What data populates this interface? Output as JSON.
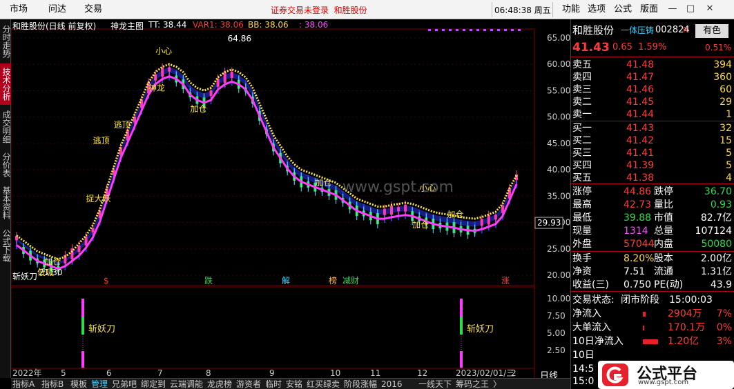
{
  "menubar": {
    "items": [
      "市场",
      "问达",
      "交易"
    ],
    "notice_left": "证券交易未登录",
    "notice_right": "和胜股份",
    "clock": "06:48:38 周五",
    "right_items": [
      "功能",
      "选项",
      "公式",
      "版面"
    ],
    "win_buttons": [
      "—",
      "□",
      "✕"
    ]
  },
  "left_tabs": [
    {
      "label": "分时走势",
      "active": false
    },
    {
      "label": "技术分析",
      "active": true
    },
    {
      "label": "成交明细",
      "active": false
    },
    {
      "label": "分价表",
      "active": false
    },
    {
      "label": "基本资料",
      "active": false
    },
    {
      "label": "公式下载",
      "active": false
    }
  ],
  "chart_header": {
    "name": "和胜股份(日线 前复权)",
    "indicator": "神龙主图",
    "tt": "TT: 38.44",
    "var1": "VAR1: 38.06",
    "bb": "BB: 38.06",
    "last": ": 38.06",
    "arrow": "↑"
  },
  "price_axis": [
    "65.00",
    "60.00",
    "55.00",
    "50.00",
    "45.00",
    "40.00",
    "35.00",
    "30.00",
    "25.00",
    "20.00"
  ],
  "current_price_tag": "29.93",
  "sub_axis": [
    "10.00",
    "7.50",
    "5.00",
    "2.50"
  ],
  "date_axis": [
    "2022年",
    "5",
    "6",
    "7",
    "8",
    "9",
    "10",
    "11",
    "12",
    "2023/02/01/三",
    "2"
  ],
  "period_label": "日线",
  "sub_indicator": "斩妖刀",
  "sub_marker_label": "斩妖刀",
  "annotations": {
    "high": "64.86",
    "low": "21.30",
    "small_heart": "小心",
    "jiacang": "加仓",
    "taoding": "逃顶",
    "tidayao": "捉大妖",
    "dixi": "低吸",
    "shenlong": "神龙"
  },
  "event_tags": [
    {
      "text": "$",
      "color": "#ff3b3b"
    },
    {
      "text": "跌",
      "color": "#2fdc4a"
    },
    {
      "text": "解",
      "color": "#3ad0ff"
    },
    {
      "text": "榜",
      "color": "#ffb347"
    },
    {
      "text": "减财",
      "color": "#2fdc4a"
    },
    {
      "text": "涨",
      "color": "#ff3b3b"
    }
  ],
  "quote": {
    "name": "和胜股份",
    "tag": "一体压铸",
    "code": "002824",
    "r_label": "R",
    "badge": "有色",
    "price": "41.43",
    "change": "0.65",
    "pct": "1.59%",
    "badge_pct": "0.51%",
    "asks": [
      {
        "label": "卖五",
        "price": "41.48",
        "vol": "394"
      },
      {
        "label": "卖四",
        "price": "41.47",
        "vol": "360"
      },
      {
        "label": "卖三",
        "price": "41.46",
        "vol": "60"
      },
      {
        "label": "卖二",
        "price": "41.45",
        "vol": "29"
      },
      {
        "label": "卖一",
        "price": "41.44",
        "vol": "1"
      }
    ],
    "bids": [
      {
        "label": "买一",
        "price": "41.43",
        "vol": "32"
      },
      {
        "label": "买二",
        "price": "41.42",
        "vol": "15"
      },
      {
        "label": "买三",
        "price": "41.41",
        "vol": "5"
      },
      {
        "label": "买四",
        "price": "41.39",
        "vol": "5"
      },
      {
        "label": "买五",
        "price": "41.38",
        "vol": "4"
      }
    ],
    "stats": [
      {
        "l1": "涨停",
        "v1": "44.86",
        "c1": "red",
        "l2": "跌停",
        "v2": "36.70",
        "c2": "green"
      },
      {
        "l1": "最高",
        "v1": "42.73",
        "c1": "red",
        "l2": "量比",
        "v2": "0.93",
        "c2": "green"
      },
      {
        "l1": "最低",
        "v1": "39.88",
        "c1": "green",
        "l2": "市值",
        "v2": "82.7亿",
        "c2": "white"
      },
      {
        "l1": "现量",
        "v1": "1314",
        "c1": "mag",
        "l2": "总量",
        "v2": "107124",
        "c2": "white"
      },
      {
        "l1": "外盘",
        "v1": "57044",
        "c1": "red",
        "l2": "内盘",
        "v2": "50080",
        "c2": "green"
      }
    ],
    "stats2": [
      {
        "l1": "换手",
        "v1": "8.20%",
        "c1": "yellow",
        "l2": "股本",
        "v2": "2.00亿",
        "c2": "white"
      },
      {
        "l1": "净资",
        "v1": "7.51",
        "c1": "white",
        "l2": "流通",
        "v2": "1.31亿",
        "c2": "white"
      },
      {
        "l1": "收益(三)",
        "v1": "0.750",
        "c1": "white",
        "l2": "PE(动)",
        "v2": "43.9",
        "c2": "white"
      }
    ],
    "status_label": "交易状态:",
    "status_value": "闭市阶段",
    "status_time": "15:00:03",
    "flows": [
      {
        "label": "净流入",
        "value": "2904万",
        "pct": "7%"
      },
      {
        "label": "大单流入",
        "value": "170.1万",
        "pct": "0%"
      },
      {
        "label": "10日净流入",
        "value": "1.20亿",
        "pct": "3%"
      },
      {
        "label": "10日",
        "value": "",
        "pct": ""
      }
    ],
    "bottom_times": [
      "14:5",
      "15:0"
    ]
  },
  "bottom_tabs": [
    "指标A",
    "指标B",
    "模板",
    "管理",
    "兄弟吧",
    "绑定到",
    "云端调能",
    "龙虎榜",
    "游资者",
    "临时",
    "安铭",
    "红买绿卖",
    "阶段涨幅",
    "2016",
    "一线天下",
    "筹码之王",
    "〉"
  ],
  "bottom_active": "管理",
  "watermark": {
    "text": "公式平台",
    "url": "www.gspt.com"
  },
  "site_watermark": "www.gspt.com",
  "chart_data": {
    "type": "line",
    "title": "",
    "xlabel": "",
    "ylabel": "",
    "ylim": [
      20,
      65
    ],
    "series": [
      {
        "name": "TT",
        "values": [
          27,
          26,
          25,
          24,
          23.5,
          23,
          22.5,
          23,
          24,
          25.5,
          27,
          29,
          32,
          36,
          40,
          44,
          47,
          50,
          53,
          56,
          58,
          59,
          59.5,
          59,
          58,
          56,
          55,
          54.5,
          55,
          57,
          58,
          58.5,
          58,
          57,
          55,
          52,
          49,
          46,
          44,
          42,
          40.5,
          39.5,
          39,
          38.5,
          38,
          37.5,
          37,
          36,
          35,
          34,
          33.5,
          33,
          32.5,
          32.5,
          32.8,
          33,
          33.2,
          33,
          32.5,
          32,
          31.5,
          31.2,
          31,
          30.8,
          30.5,
          30.3,
          30.2,
          30.5,
          31,
          31.5,
          33,
          36,
          38.4
        ]
      },
      {
        "name": "VAR1",
        "values": [
          26.5,
          25.5,
          24.5,
          23.5,
          23,
          22.5,
          22,
          22.5,
          23.5,
          24.5,
          26,
          28,
          31,
          35,
          39,
          43,
          46,
          49,
          52,
          55,
          57,
          58,
          58.5,
          58,
          57,
          55,
          54,
          53.5,
          54,
          56,
          57,
          57.5,
          57,
          56,
          54,
          51,
          48,
          45,
          43,
          41,
          39.5,
          38.5,
          38,
          37.5,
          37,
          36.5,
          36,
          35,
          34,
          33,
          32.5,
          32,
          31.5,
          31.5,
          31.8,
          32,
          32.2,
          32,
          31.5,
          31,
          30.5,
          30.2,
          30,
          29.8,
          29.5,
          29.3,
          29.2,
          29.5,
          30,
          30.5,
          32,
          35,
          38.06
        ]
      }
    ],
    "markers": [
      {
        "label": "64.86",
        "value": 64.86
      },
      {
        "label": "21.30",
        "value": 21.3
      }
    ],
    "sub_chart": {
      "name": "斩妖刀",
      "ylim": [
        0,
        10
      ],
      "signals": [
        {
          "index": 13,
          "value": 10
        },
        {
          "index": 69,
          "value": 10
        }
      ]
    }
  }
}
